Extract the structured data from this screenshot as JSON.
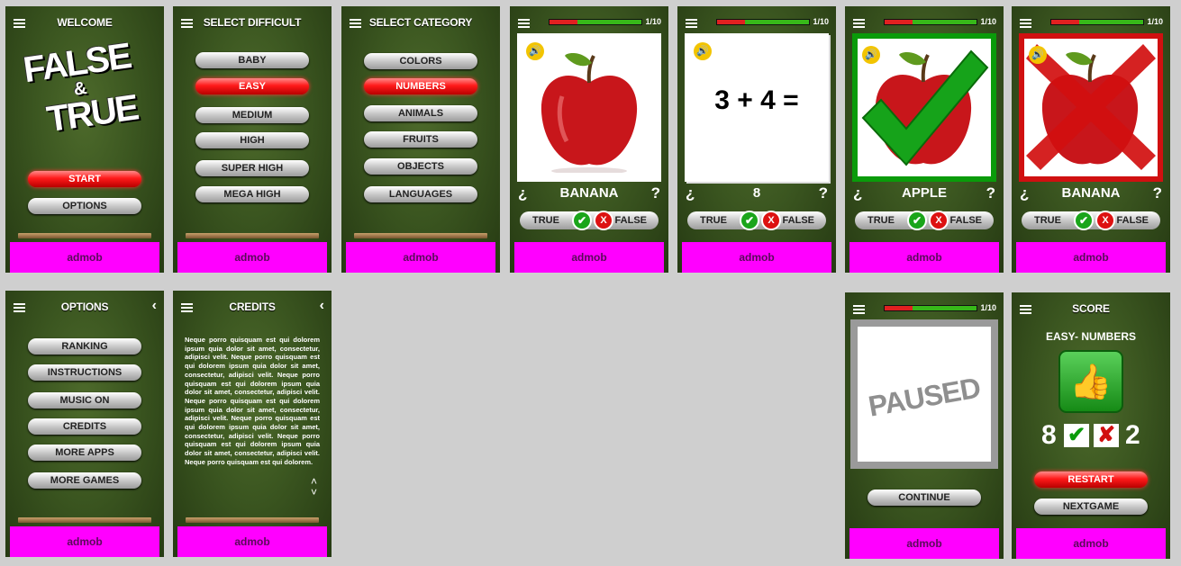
{
  "welcome": {
    "title": "WELCOME",
    "logo_line1": "FALSE",
    "logo_amp": "&",
    "logo_line2": "TRUE",
    "start": "START",
    "options": "OPTIONS",
    "ad": "admob"
  },
  "difficulty": {
    "title": "SELECT DIFFICULT",
    "items": [
      "BABY",
      "EASY",
      "MEDIUM",
      "HIGH",
      "SUPER HIGH",
      "MEGA HIGH"
    ],
    "selected": "EASY",
    "ad": "admob"
  },
  "category": {
    "title": "SELECT CATEGORY",
    "items": [
      "COLORS",
      "NUMBERS",
      "ANIMALS",
      "FRUITS",
      "OBJECTS",
      "LANGUAGES"
    ],
    "selected": "NUMBERS",
    "ad": "admob"
  },
  "game_common": {
    "progress": "1/10",
    "progress_fraction": 0.3,
    "true_label": "TRUE",
    "false_label": "FALSE",
    "q_open": "¿",
    "q_close": "?",
    "ad": "admob"
  },
  "game1": {
    "word": "BANANA",
    "picture": "apple-image"
  },
  "game2": {
    "word": "8",
    "expression": "3 + 4 ="
  },
  "game3": {
    "word": "APPLE",
    "picture": "apple-image",
    "mark": "check-mark"
  },
  "game4": {
    "word": "BANANA",
    "picture": "apple-image",
    "mark": "cross-mark"
  },
  "options": {
    "title": "OPTIONS",
    "items": [
      "RANKING",
      "INSTRUCTIONS",
      "MUSIC ON",
      "CREDITS",
      "MORE APPS",
      "MORE GAMES"
    ],
    "ad": "admob"
  },
  "credits": {
    "title": "CREDITS",
    "body": "Neque porro quisquam est qui dolorem ipsum quia dolor sit amet, consectetur, adipisci velit. Neque porro quisquam est qui dolorem ipsum quia dolor sit amet, consectetur, adipisci velit. Neque porro quisquam est qui dolorem ipsum quia dolor sit amet, consectetur, adipisci velit. Neque porro quisquam est qui dolorem ipsum quia dolor sit amet, consectetur, adipisci velit. Neque porro quisquam est qui dolorem ipsum quia dolor sit amet, consectetur, adipisci velit. Neque porro quisquam est qui dolorem ipsum quia dolor sit amet, consectetur, adipisci velit. Neque porro quisquam est qui dolorem.",
    "ad": "admob"
  },
  "paused": {
    "progress": "1/10",
    "label": "PAUSED",
    "continue": "CONTINUE",
    "ad": "admob"
  },
  "score": {
    "title": "SCORE",
    "subtitle": "EASY- NUMBERS",
    "correct": "8",
    "wrong": "2",
    "restart": "RESTART",
    "nextgame": "NEXTGAME",
    "ad": "admob"
  },
  "colors": {
    "accent_red": "#ff1a1a",
    "ad_magenta": "#ff00ff",
    "correct_green": "#0a9b0a",
    "wrong_red": "#d01010"
  }
}
